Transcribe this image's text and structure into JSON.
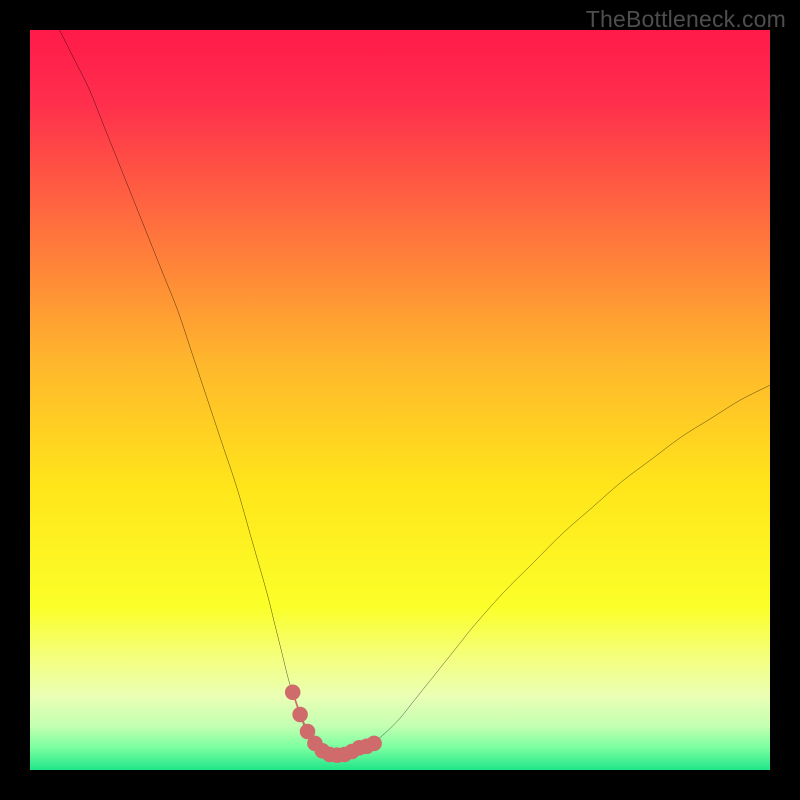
{
  "watermark": "TheBottleneck.com",
  "gradient_stops": [
    {
      "offset": 0.0,
      "color": "#ff1a4a"
    },
    {
      "offset": 0.1,
      "color": "#ff2f4c"
    },
    {
      "offset": 0.25,
      "color": "#ff6a3f"
    },
    {
      "offset": 0.45,
      "color": "#ffb72c"
    },
    {
      "offset": 0.62,
      "color": "#ffe61a"
    },
    {
      "offset": 0.78,
      "color": "#fbff29"
    },
    {
      "offset": 0.85,
      "color": "#f4ff80"
    },
    {
      "offset": 0.9,
      "color": "#eaffb4"
    },
    {
      "offset": 0.94,
      "color": "#c4ffb2"
    },
    {
      "offset": 0.97,
      "color": "#7affa0"
    },
    {
      "offset": 1.0,
      "color": "#20e68a"
    }
  ],
  "chart_data": {
    "type": "line",
    "title": "",
    "xlabel": "",
    "ylabel": "",
    "x_range": [
      0,
      100
    ],
    "y_range": [
      0,
      100
    ],
    "series": [
      {
        "name": "bottleneck-curve",
        "x": [
          4,
          6,
          8,
          10,
          12,
          14,
          16,
          18,
          20,
          22,
          24,
          26,
          28,
          30,
          32,
          33,
          34,
          35,
          36,
          37,
          38,
          39,
          40,
          41,
          42,
          43,
          44,
          46,
          48,
          50,
          52,
          54,
          56,
          58,
          60,
          64,
          68,
          72,
          76,
          80,
          84,
          88,
          92,
          96,
          100
        ],
        "y": [
          100,
          96,
          92,
          87,
          82,
          77,
          72,
          67,
          62,
          56,
          50,
          44,
          38,
          31,
          24,
          20,
          16,
          12,
          9,
          6,
          4,
          3,
          2.2,
          2,
          2,
          2.2,
          2.6,
          3.4,
          5,
          7,
          9.5,
          12,
          14.5,
          17,
          19.5,
          24,
          28,
          32,
          35.5,
          39,
          42,
          45,
          47.5,
          50,
          52
        ]
      },
      {
        "name": "highlight-segment",
        "x": [
          35.5,
          36.5,
          37.5,
          38.5,
          39.5,
          40.5,
          41.5,
          42.5,
          43.5,
          44.5,
          45.5,
          46.5
        ],
        "y": [
          10.5,
          7.5,
          5.2,
          3.6,
          2.6,
          2.1,
          2.0,
          2.1,
          2.5,
          3.0,
          3.2,
          3.6
        ]
      }
    ],
    "highlight_color": "#cf6b6b",
    "curve_color": "#000000"
  }
}
